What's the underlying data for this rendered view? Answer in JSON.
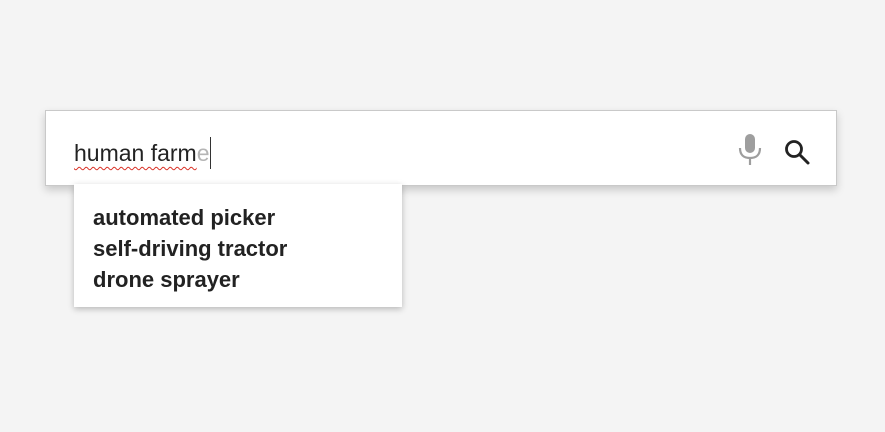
{
  "search": {
    "typed_text": "human farm",
    "completion_text": "e"
  },
  "icons": {
    "mic": "microphone-icon",
    "search": "search-icon"
  },
  "suggestions": [
    "automated picker",
    "self-driving tractor",
    "drone sprayer"
  ],
  "colors": {
    "background": "#f4f4f4",
    "spellcheck_underline": "#d93025",
    "completion_text": "#b5b5b5",
    "mic_gray": "#9e9e9e"
  }
}
